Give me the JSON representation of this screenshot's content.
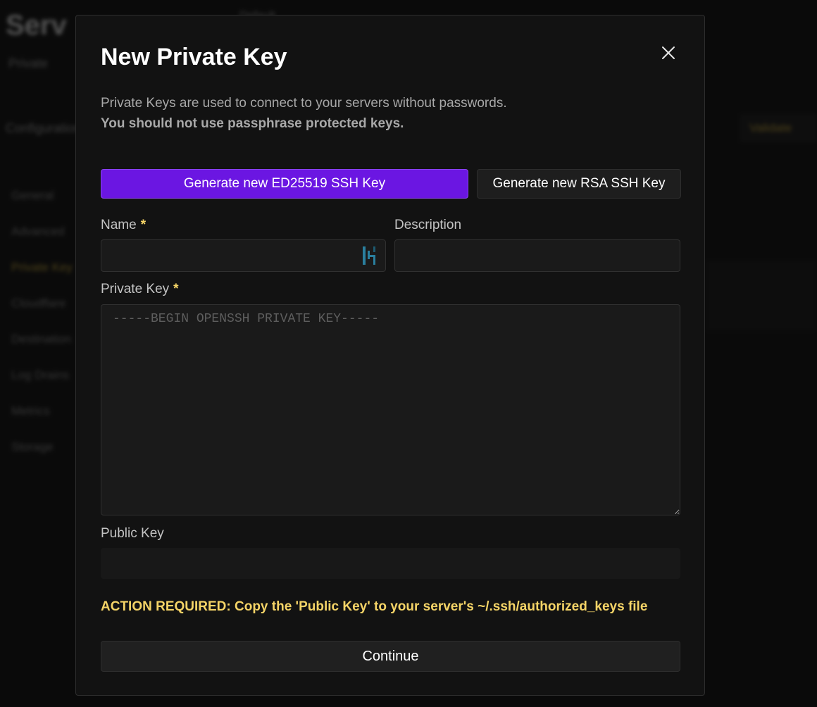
{
  "background": {
    "title": "Serv",
    "tab": "Default",
    "subtitle": "Private",
    "section": "Configuration",
    "right_button": "Validate",
    "sidebar": [
      "General",
      "Advanced",
      "Private Key",
      "Cloudflare",
      "Destination",
      "Log Drains",
      "Metrics",
      "Storage"
    ]
  },
  "modal": {
    "title": "New Private Key",
    "close_icon": "close-icon",
    "intro_line1": "Private Keys are used to connect to your servers without passwords.",
    "intro_line2": "You should not use passphrase protected keys.",
    "generate_ed25519_label": "Generate new ED25519 SSH Key",
    "generate_rsa_label": "Generate new RSA SSH Key",
    "name_label": "Name",
    "required_marker": "*",
    "name_value": "",
    "description_label": "Description",
    "description_value": "",
    "private_key_label": "Private Key",
    "private_key_placeholder": "-----BEGIN OPENSSH PRIVATE KEY-----",
    "private_key_value": "",
    "public_key_label": "Public Key",
    "public_key_value": "",
    "action_note": "ACTION REQUIRED: Copy the 'Public Key' to your server's ~/.ssh/authorized_keys file",
    "continue_label": "Continue"
  },
  "colors": {
    "primary": "#6b16e2",
    "warning": "#f5d467",
    "background": "#121212"
  }
}
